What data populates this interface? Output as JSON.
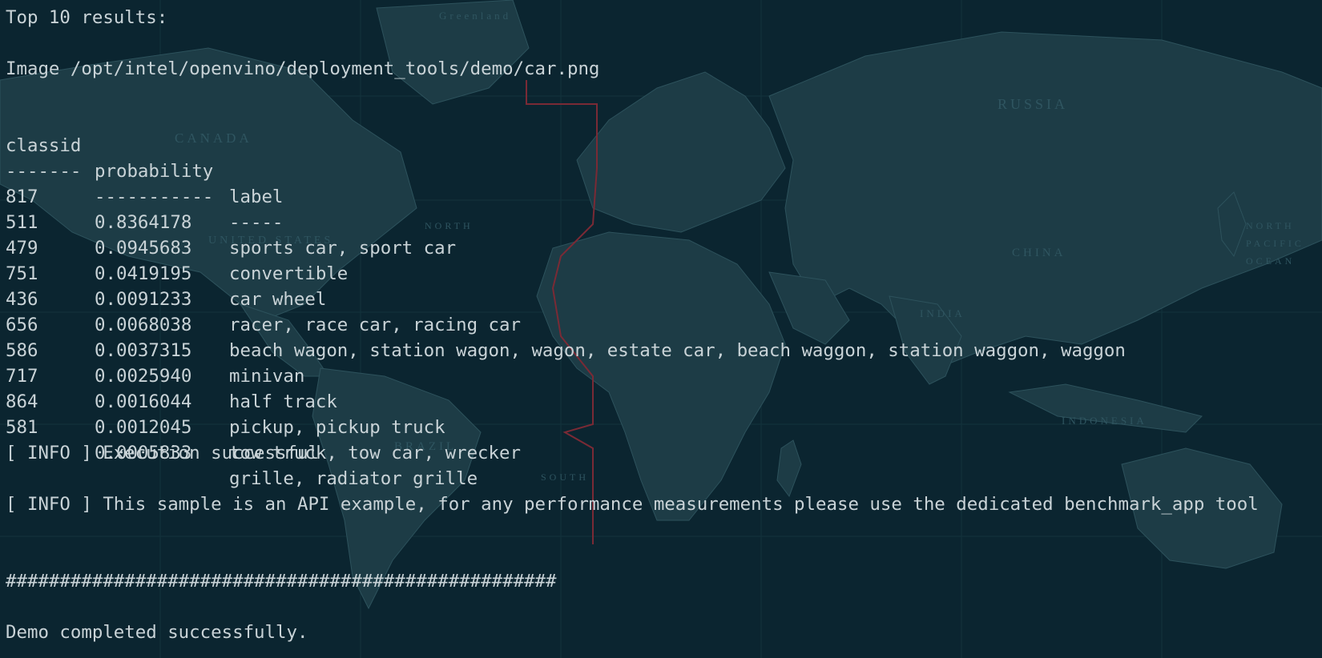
{
  "terminal": {
    "heading": "Top 10 results:",
    "image_line": "Image /opt/intel/openvino/deployment_tools/demo/car.png",
    "columns": {
      "classid": "classid",
      "probability": "probability",
      "label": "label"
    },
    "separators": {
      "classid": "-------",
      "probability": "-----------",
      "label": "-----"
    },
    "results": [
      {
        "classid": "817",
        "probability": "0.8364178",
        "label": "sports car, sport car"
      },
      {
        "classid": "511",
        "probability": "0.0945683",
        "label": "convertible"
      },
      {
        "classid": "479",
        "probability": "0.0419195",
        "label": "car wheel"
      },
      {
        "classid": "751",
        "probability": "0.0091233",
        "label": "racer, race car, racing car"
      },
      {
        "classid": "436",
        "probability": "0.0068038",
        "label": "beach wagon, station wagon, wagon, estate car, beach waggon, station waggon, waggon"
      },
      {
        "classid": "656",
        "probability": "0.0037315",
        "label": "minivan"
      },
      {
        "classid": "586",
        "probability": "0.0025940",
        "label": "half track"
      },
      {
        "classid": "717",
        "probability": "0.0016044",
        "label": "pickup, pickup truck"
      },
      {
        "classid": "864",
        "probability": "0.0012045",
        "label": "tow truck, tow car, wrecker"
      },
      {
        "classid": "581",
        "probability": "0.0005833",
        "label": "grille, radiator grille"
      }
    ],
    "info_success": "[ INFO ] Execution successful",
    "info_note": "[ INFO ] This sample is an API example, for any performance measurements please use the dedicated benchmark_app tool",
    "hash_line": "###################################################",
    "completed": "Demo completed successfully."
  },
  "colors": {
    "background": "#0b2530",
    "text": "#c9d3d7",
    "map_land": "#1d3c46",
    "timezone_line": "#7a2a35"
  },
  "wallpaper": {
    "labels": [
      "RUSSIA",
      "CHINA",
      "CANADA",
      "BRAZIL",
      "INDIA",
      "INDONESIA",
      "NORTH",
      "PACIFIC",
      "OCEAN",
      "UNITED STATES",
      "SOUTH",
      "Greenland"
    ]
  }
}
